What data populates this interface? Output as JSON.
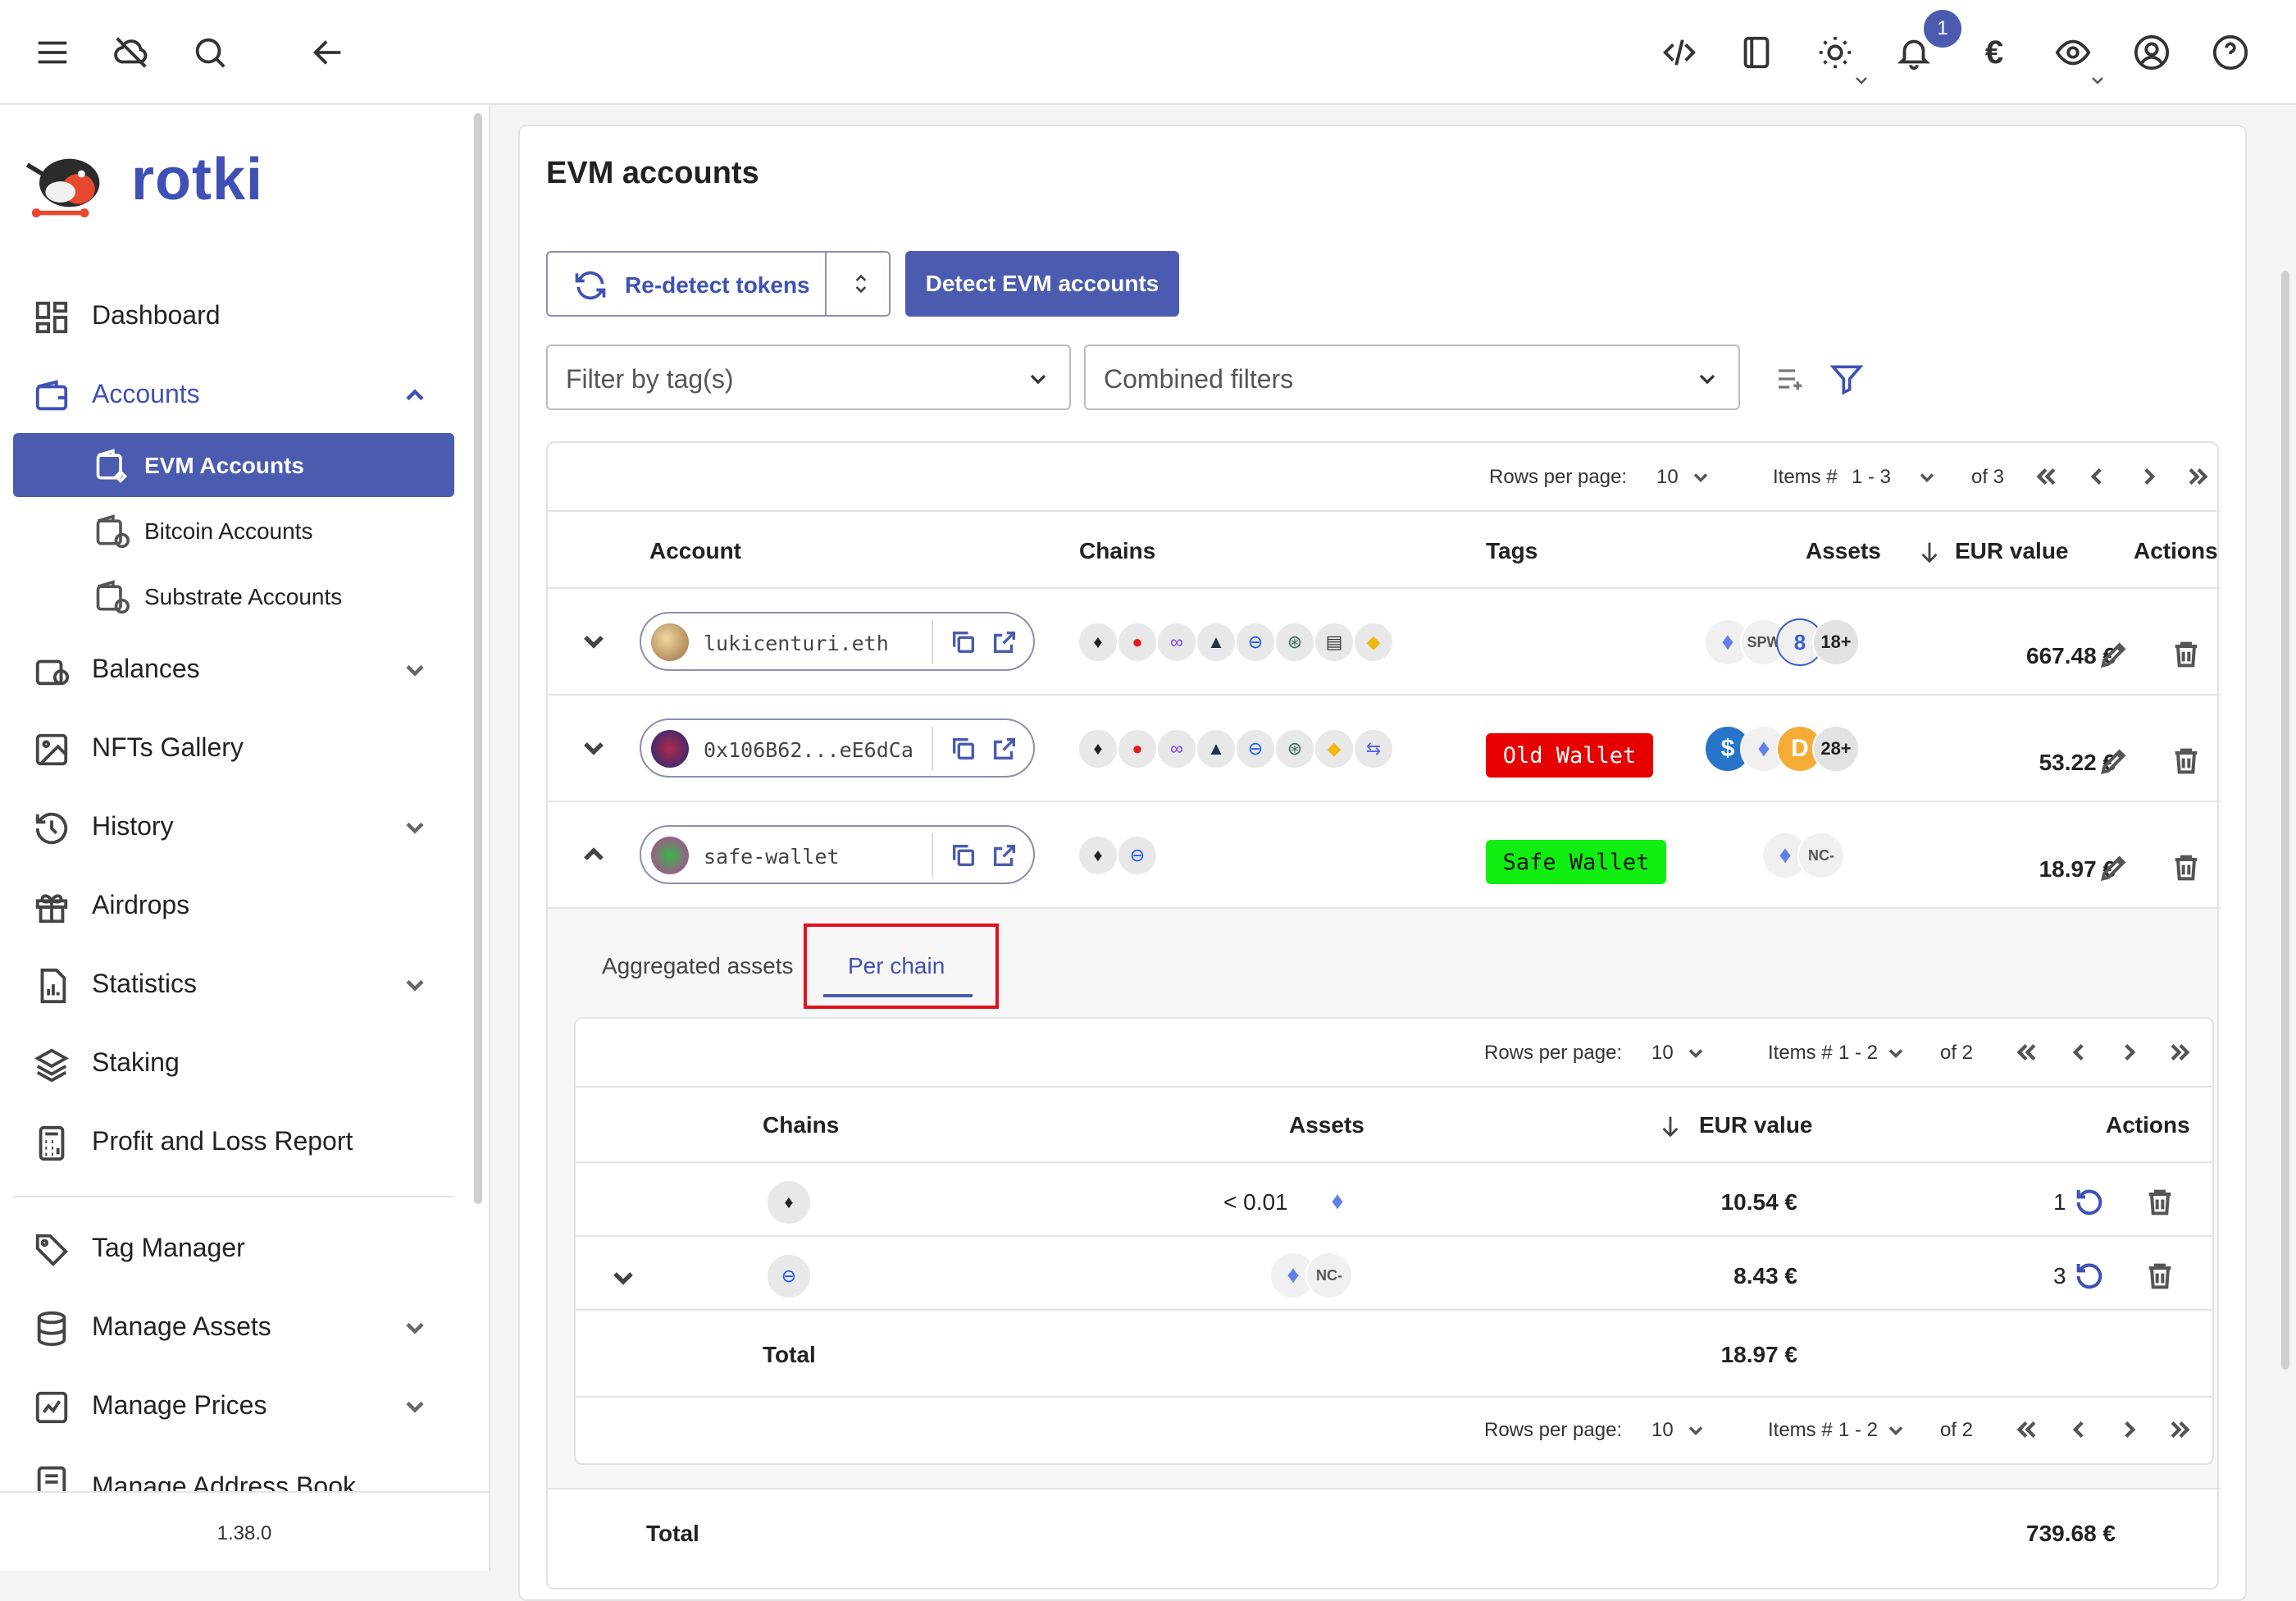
{
  "topbar": {
    "notification_count": "1",
    "currency_symbol": "€",
    "icons": [
      "menu-icon",
      "cloud-off-icon",
      "search-icon",
      "back-arrow-icon",
      "code-icon",
      "notes-icon",
      "sun-icon",
      "bell-icon",
      "euro-icon",
      "eye-icon",
      "user-icon",
      "help-icon"
    ]
  },
  "sidebar": {
    "brand": "rotki",
    "version": "1.38.0",
    "items": [
      {
        "label": "Dashboard"
      },
      {
        "label": "Accounts"
      },
      {
        "label": "Balances"
      },
      {
        "label": "NFTs Gallery"
      },
      {
        "label": "History"
      },
      {
        "label": "Airdrops"
      },
      {
        "label": "Statistics"
      },
      {
        "label": "Staking"
      },
      {
        "label": "Profit and Loss Report"
      },
      {
        "label": "Tag Manager"
      },
      {
        "label": "Manage Assets"
      },
      {
        "label": "Manage Prices"
      },
      {
        "label": "Manage Address Book"
      }
    ],
    "sub_items": [
      {
        "label": "EVM Accounts"
      },
      {
        "label": "Bitcoin Accounts"
      },
      {
        "label": "Substrate Accounts"
      }
    ]
  },
  "main": {
    "title": "EVM accounts",
    "redetect_label": "Re-detect tokens",
    "detect_label": "Detect EVM accounts",
    "filter_tags_placeholder": "Filter by tag(s)",
    "combined_filters_placeholder": "Combined filters"
  },
  "pager": {
    "rows_per_page_label": "Rows per page:",
    "rows_value": "10",
    "items_label": "Items #",
    "range": "1 - 3",
    "of": "of 3"
  },
  "table": {
    "headers": {
      "account": "Account",
      "chains": "Chains",
      "tags": "Tags",
      "assets": "Assets",
      "value": "EUR value",
      "actions": "Actions"
    },
    "rows": [
      {
        "name": "lukicenturi.eth",
        "tag": "",
        "more": "18+",
        "value": "667.48 €"
      },
      {
        "name": "0x106B62...eE6dCa",
        "tag": "Old Wallet",
        "more": "28+",
        "value": "53.22 €"
      },
      {
        "name": "safe-wallet",
        "tag": "Safe Wallet",
        "more": "",
        "value": "18.97 €"
      }
    ],
    "total_label": "Total",
    "total_value": "739.68 €"
  },
  "expanded": {
    "tab_aggregated": "Aggregated assets",
    "tab_per_chain": "Per chain",
    "pager": {
      "rows_per_page_label": "Rows per page:",
      "rows_value": "10",
      "items_label": "Items #",
      "range": "1 - 2",
      "of": "of 2"
    },
    "headers": {
      "chains": "Chains",
      "assets": "Assets",
      "value": "EUR value",
      "actions": "Actions"
    },
    "rows": [
      {
        "assets_text": "< 0.01",
        "value": "10.54 €",
        "count": "1"
      },
      {
        "assets_text": "",
        "value": "8.43 €",
        "count": "3"
      }
    ],
    "total_label": "Total",
    "total_value": "18.97 €"
  },
  "asset_labels": {
    "spw": "SPW",
    "nc": "NC-"
  },
  "colors": {
    "accent": "#4a5bb0",
    "old_wallet": "#e60000",
    "safe_wallet": "#11ee11",
    "highlight": "#e0101c"
  }
}
